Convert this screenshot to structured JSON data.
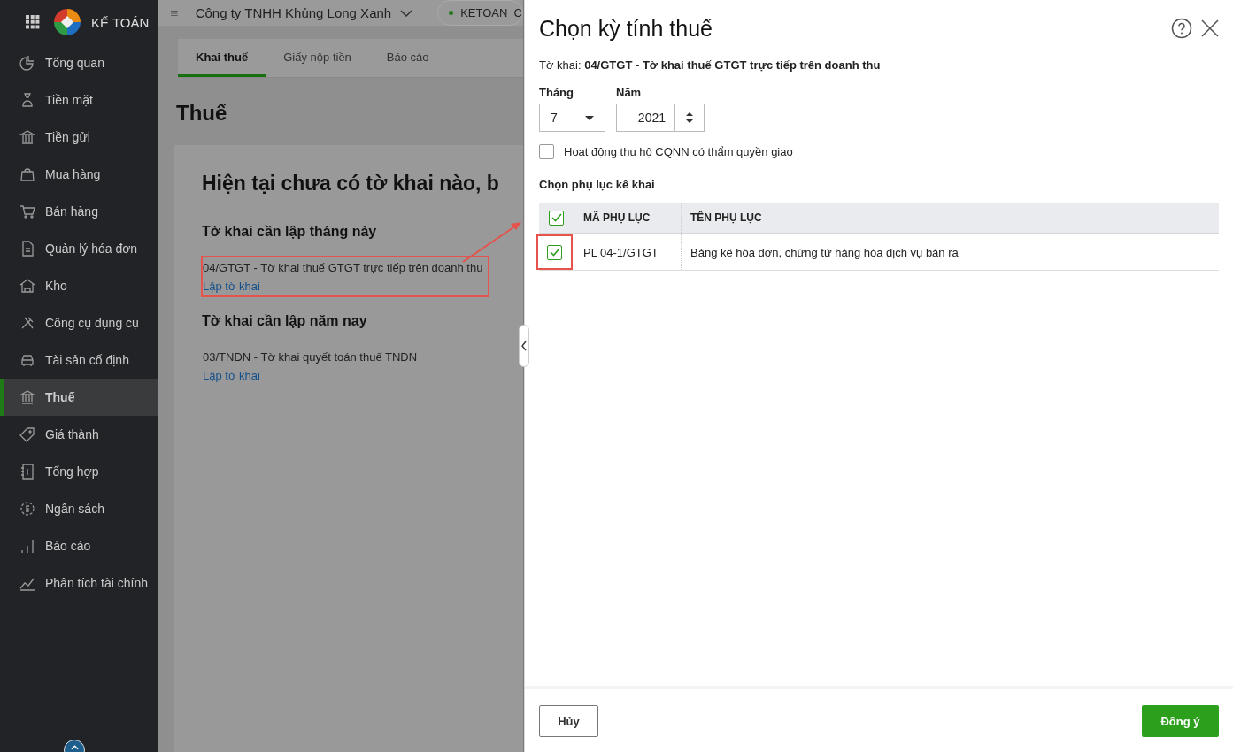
{
  "logo": {
    "text": "KẾ TOÁN"
  },
  "sidebar": {
    "items": [
      {
        "label": "Tổng quan",
        "selected": false
      },
      {
        "label": "Tiền mặt",
        "selected": false
      },
      {
        "label": "Tiền gửi",
        "selected": false
      },
      {
        "label": "Mua hàng",
        "selected": false
      },
      {
        "label": "Bán hàng",
        "selected": false
      },
      {
        "label": "Quản lý hóa đơn",
        "selected": false
      },
      {
        "label": "Kho",
        "selected": false
      },
      {
        "label": "Công cụ dụng cụ",
        "selected": false
      },
      {
        "label": "Tài sản cố định",
        "selected": false
      },
      {
        "label": "Thuế",
        "selected": true
      },
      {
        "label": "Giá thành",
        "selected": false
      },
      {
        "label": "Tổng hợp",
        "selected": false
      },
      {
        "label": "Ngân sách",
        "selected": false
      },
      {
        "label": "Báo cáo",
        "selected": false
      },
      {
        "label": "Phân tích tài chính",
        "selected": false
      }
    ]
  },
  "header": {
    "company": "Công ty TNHH Khủng Long Xanh",
    "database": "KETOAN_C"
  },
  "tabs": [
    {
      "label": "Khai thuế",
      "selected": true
    },
    {
      "label": "Giấy nộp tiền",
      "selected": false
    },
    {
      "label": "Báo cáo",
      "selected": false
    }
  ],
  "page_title": "Thuế",
  "empty_state": {
    "heading": "Hiện tại chưa có tờ khai nào, b",
    "sections": [
      {
        "title": "Tờ khai cần lập tháng này",
        "items": [
          {
            "form": "04/GTGT - Tờ khai thuế GTGT trực tiếp trên doanh thu",
            "link": "Lập tờ khai",
            "highlighted": true
          }
        ]
      },
      {
        "title": "Tờ khai cần lập năm nay",
        "items": [
          {
            "form": "03/TNDN - Tờ khai quyết toán thuế TNDN",
            "link": "Lập tờ khai",
            "highlighted": false
          }
        ]
      }
    ]
  },
  "dialog": {
    "title": "Chọn kỳ tính thuế",
    "form_label": "Tờ khai:",
    "form_name": "04/GTGT - Tờ khai thuế GTGT trực tiếp trên doanh thu",
    "month": {
      "label": "Tháng",
      "value": "7"
    },
    "year": {
      "label": "Năm",
      "value": "2021"
    },
    "delegated_collection": {
      "label": "Hoạt động thu hộ CQNN có thẩm quyền giao",
      "checked": false
    },
    "appendix_title": "Chọn phụ lục kê khai",
    "table": {
      "all_checked": true,
      "columns": [
        "MÃ PHỤ LỤC",
        "TÊN PHỤ LỤC"
      ],
      "rows": [
        {
          "code": "PL 04-1/GTGT",
          "name": "Bảng kê hóa đơn, chứng từ hàng hóa dịch vụ bán ra",
          "checked": true,
          "highlighted": true
        }
      ]
    },
    "buttons": {
      "cancel": "Hủy",
      "confirm": "Đồng ý"
    }
  }
}
